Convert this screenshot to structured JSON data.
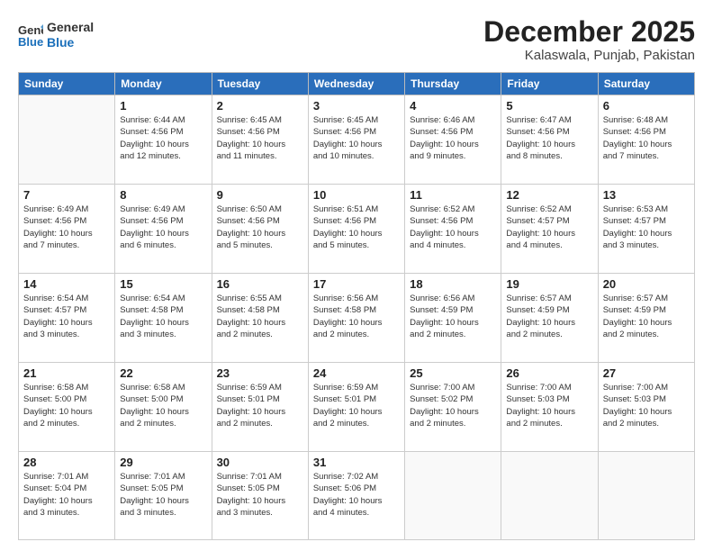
{
  "logo": {
    "line1": "General",
    "line2": "Blue"
  },
  "header": {
    "month": "December 2025",
    "location": "Kalaswala, Punjab, Pakistan"
  },
  "weekdays": [
    "Sunday",
    "Monday",
    "Tuesday",
    "Wednesday",
    "Thursday",
    "Friday",
    "Saturday"
  ],
  "weeks": [
    [
      {
        "day": "",
        "info": ""
      },
      {
        "day": "1",
        "info": "Sunrise: 6:44 AM\nSunset: 4:56 PM\nDaylight: 10 hours\nand 12 minutes."
      },
      {
        "day": "2",
        "info": "Sunrise: 6:45 AM\nSunset: 4:56 PM\nDaylight: 10 hours\nand 11 minutes."
      },
      {
        "day": "3",
        "info": "Sunrise: 6:45 AM\nSunset: 4:56 PM\nDaylight: 10 hours\nand 10 minutes."
      },
      {
        "day": "4",
        "info": "Sunrise: 6:46 AM\nSunset: 4:56 PM\nDaylight: 10 hours\nand 9 minutes."
      },
      {
        "day": "5",
        "info": "Sunrise: 6:47 AM\nSunset: 4:56 PM\nDaylight: 10 hours\nand 8 minutes."
      },
      {
        "day": "6",
        "info": "Sunrise: 6:48 AM\nSunset: 4:56 PM\nDaylight: 10 hours\nand 7 minutes."
      }
    ],
    [
      {
        "day": "7",
        "info": "Sunrise: 6:49 AM\nSunset: 4:56 PM\nDaylight: 10 hours\nand 7 minutes."
      },
      {
        "day": "8",
        "info": "Sunrise: 6:49 AM\nSunset: 4:56 PM\nDaylight: 10 hours\nand 6 minutes."
      },
      {
        "day": "9",
        "info": "Sunrise: 6:50 AM\nSunset: 4:56 PM\nDaylight: 10 hours\nand 5 minutes."
      },
      {
        "day": "10",
        "info": "Sunrise: 6:51 AM\nSunset: 4:56 PM\nDaylight: 10 hours\nand 5 minutes."
      },
      {
        "day": "11",
        "info": "Sunrise: 6:52 AM\nSunset: 4:56 PM\nDaylight: 10 hours\nand 4 minutes."
      },
      {
        "day": "12",
        "info": "Sunrise: 6:52 AM\nSunset: 4:57 PM\nDaylight: 10 hours\nand 4 minutes."
      },
      {
        "day": "13",
        "info": "Sunrise: 6:53 AM\nSunset: 4:57 PM\nDaylight: 10 hours\nand 3 minutes."
      }
    ],
    [
      {
        "day": "14",
        "info": "Sunrise: 6:54 AM\nSunset: 4:57 PM\nDaylight: 10 hours\nand 3 minutes."
      },
      {
        "day": "15",
        "info": "Sunrise: 6:54 AM\nSunset: 4:58 PM\nDaylight: 10 hours\nand 3 minutes."
      },
      {
        "day": "16",
        "info": "Sunrise: 6:55 AM\nSunset: 4:58 PM\nDaylight: 10 hours\nand 2 minutes."
      },
      {
        "day": "17",
        "info": "Sunrise: 6:56 AM\nSunset: 4:58 PM\nDaylight: 10 hours\nand 2 minutes."
      },
      {
        "day": "18",
        "info": "Sunrise: 6:56 AM\nSunset: 4:59 PM\nDaylight: 10 hours\nand 2 minutes."
      },
      {
        "day": "19",
        "info": "Sunrise: 6:57 AM\nSunset: 4:59 PM\nDaylight: 10 hours\nand 2 minutes."
      },
      {
        "day": "20",
        "info": "Sunrise: 6:57 AM\nSunset: 4:59 PM\nDaylight: 10 hours\nand 2 minutes."
      }
    ],
    [
      {
        "day": "21",
        "info": "Sunrise: 6:58 AM\nSunset: 5:00 PM\nDaylight: 10 hours\nand 2 minutes."
      },
      {
        "day": "22",
        "info": "Sunrise: 6:58 AM\nSunset: 5:00 PM\nDaylight: 10 hours\nand 2 minutes."
      },
      {
        "day": "23",
        "info": "Sunrise: 6:59 AM\nSunset: 5:01 PM\nDaylight: 10 hours\nand 2 minutes."
      },
      {
        "day": "24",
        "info": "Sunrise: 6:59 AM\nSunset: 5:01 PM\nDaylight: 10 hours\nand 2 minutes."
      },
      {
        "day": "25",
        "info": "Sunrise: 7:00 AM\nSunset: 5:02 PM\nDaylight: 10 hours\nand 2 minutes."
      },
      {
        "day": "26",
        "info": "Sunrise: 7:00 AM\nSunset: 5:03 PM\nDaylight: 10 hours\nand 2 minutes."
      },
      {
        "day": "27",
        "info": "Sunrise: 7:00 AM\nSunset: 5:03 PM\nDaylight: 10 hours\nand 2 minutes."
      }
    ],
    [
      {
        "day": "28",
        "info": "Sunrise: 7:01 AM\nSunset: 5:04 PM\nDaylight: 10 hours\nand 3 minutes."
      },
      {
        "day": "29",
        "info": "Sunrise: 7:01 AM\nSunset: 5:05 PM\nDaylight: 10 hours\nand 3 minutes."
      },
      {
        "day": "30",
        "info": "Sunrise: 7:01 AM\nSunset: 5:05 PM\nDaylight: 10 hours\nand 3 minutes."
      },
      {
        "day": "31",
        "info": "Sunrise: 7:02 AM\nSunset: 5:06 PM\nDaylight: 10 hours\nand 4 minutes."
      },
      {
        "day": "",
        "info": ""
      },
      {
        "day": "",
        "info": ""
      },
      {
        "day": "",
        "info": ""
      }
    ]
  ]
}
